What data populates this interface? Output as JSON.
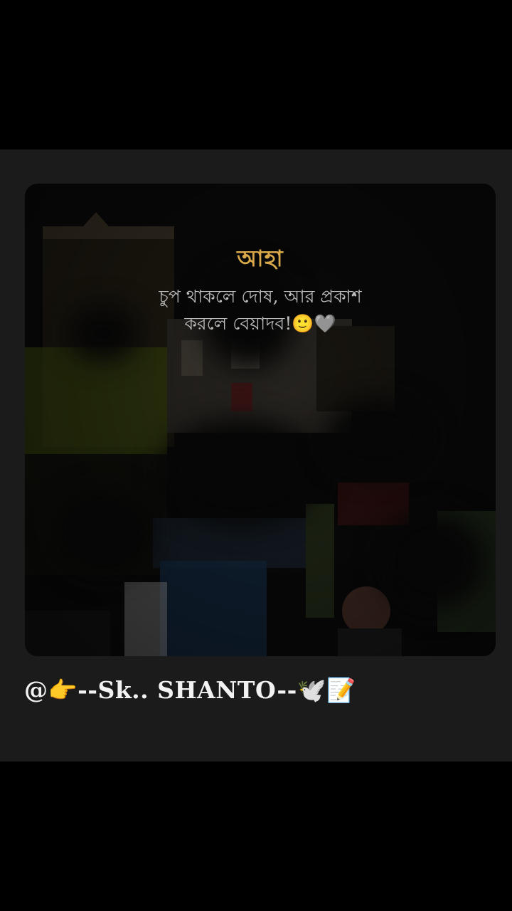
{
  "post": {
    "caption": {
      "title": "আহা",
      "line1": "চুপ থাকলে দোষ, আর প্রকাশ",
      "line2": "করলে বেয়াদব!🙂🩶"
    },
    "username": "@👉--Sk.. SHANTO--🕊️📝"
  },
  "colors": {
    "background": "#000000",
    "panel": "#1b1b1b",
    "caption_title": "#d9a94a",
    "caption_text": "#bdbdbd",
    "username_text": "#f2f2f2"
  }
}
